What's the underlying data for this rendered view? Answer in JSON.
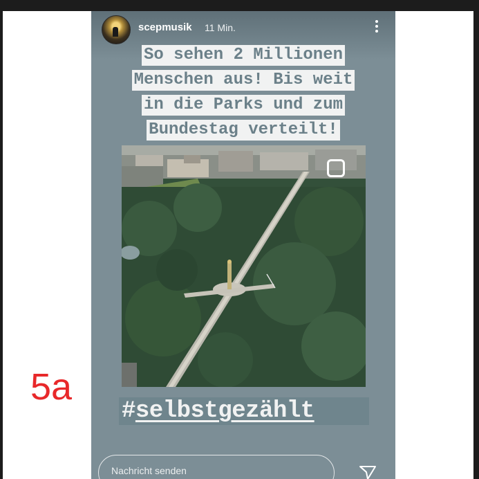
{
  "figure_label": "5a",
  "story": {
    "username": "scepmusik",
    "timestamp": "11 Min.",
    "caption_lines": [
      "So sehen 2 Millionen",
      "Menschen aus! Bis weit",
      "in die Parks und zum",
      "Bundestag verteilt!"
    ],
    "hashtag_symbol": "#",
    "hashtag_text": "selbstgezählt",
    "reply_placeholder": "Nachricht senden",
    "icons": {
      "avatar": "avatar-image",
      "menu": "more-vertical-icon",
      "repost": "repost-square-icon",
      "send": "send-paper-plane-icon"
    },
    "colors": {
      "story_background": "#7c8e96",
      "caption_text": "#6b8089",
      "caption_highlight": "#f1f2f2",
      "figure_label": "#e8282a"
    }
  }
}
